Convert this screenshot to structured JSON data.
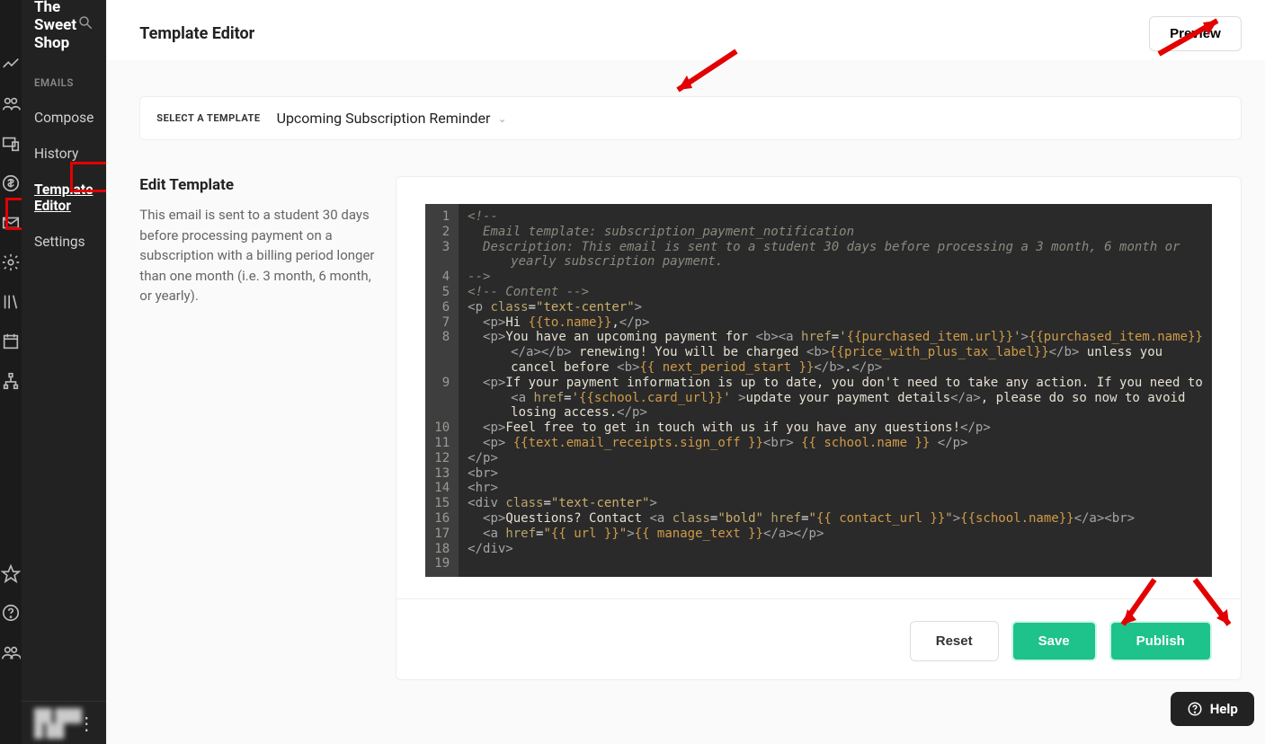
{
  "site_name": "The Sweet Shop",
  "sidebar": {
    "section_label": "EMAILS",
    "items": [
      {
        "label": "Compose"
      },
      {
        "label": "History"
      },
      {
        "label": "Template Editor"
      },
      {
        "label": "Settings"
      }
    ]
  },
  "footer_text": "██ ███ █ ██",
  "header": {
    "title": "Template Editor",
    "preview_label": "Preview"
  },
  "template_select": {
    "label": "SELECT A TEMPLATE",
    "value": "Upcoming Subscription Reminder"
  },
  "edit_info": {
    "title": "Edit Template",
    "description": "This email is sent to a student 30 days before processing payment on a subscription with a billing period longer than one month (i.e. 3 month, 6 month, or yearly)."
  },
  "actions": {
    "reset": "Reset",
    "save": "Save",
    "publish": "Publish"
  },
  "help_label": "Help",
  "code": {
    "lines": [
      {
        "n": 1,
        "html": "<span class='cm'>&lt;!--</span>"
      },
      {
        "n": 2,
        "html": "<span class='cm'>  Email template: subscription_payment_notification</span>"
      },
      {
        "n": 3,
        "html": "<span class='cm'>  Description: This email is sent to a student 30 days before processing a 3 month, 6 month or</span><span class='wrap cm'>yearly subscription payment.</span>"
      },
      {
        "n": 4,
        "html": "<span class='cm'>--&gt;</span>"
      },
      {
        "n": 5,
        "html": "<span class='cm'>&lt;!-- Content --&gt;</span>"
      },
      {
        "n": 6,
        "html": "<span class='tag'>&lt;p </span><span class='attr'>class</span>=<span class='str'>\"text-center\"</span><span class='tag'>&gt;</span>"
      },
      {
        "n": 7,
        "html": "  <span class='tag'>&lt;p&gt;</span><span class='txt'>Hi </span><span class='var'>{{to.name}}</span><span class='txt'>,</span><span class='tag'>&lt;/p&gt;</span>"
      },
      {
        "n": 8,
        "html": "  <span class='tag'>&lt;p&gt;</span><span class='txt'>You have an upcoming payment for </span><span class='tag'>&lt;b&gt;&lt;a </span><span class='attr'>href</span>=<span class='str'>'</span><span class='var'>{{purchased_item.url}}</span><span class='str'>'</span><span class='tag'>&gt;</span><span class='var'>{{purchased_item.name}}</span><span class='wrap'><span class='tag'>&lt;/a&gt;&lt;/b&gt;</span><span class='txt'> renewing! You will be charged </span><span class='tag'>&lt;b&gt;</span><span class='var'>{{price_with_plus_tax_label}}</span><span class='tag'>&lt;/b&gt;</span><span class='txt'> unless you</span></span><span class='wrap'><span class='txt'>cancel before </span><span class='tag'>&lt;b&gt;</span><span class='var'>{{ next_period_start }}</span><span class='tag'>&lt;/b&gt;</span><span class='txt'>.</span><span class='tag'>&lt;/p&gt;</span></span>"
      },
      {
        "n": 9,
        "html": "  <span class='tag'>&lt;p&gt;</span><span class='txt'>If your payment information is up to date, you don't need to take any action. If you need to</span><span class='wrap'><span class='tag'>&lt;a </span><span class='attr'>href</span>=<span class='str'>'</span><span class='var'>{{school.card_url}}</span><span class='str'>'</span><span class='tag'> &gt;</span><span class='txt'>update your payment details</span><span class='tag'>&lt;/a&gt;</span><span class='txt'>, please do so now to avoid</span></span><span class='wrap'><span class='txt'>losing access.</span><span class='tag'>&lt;/p&gt;</span></span>"
      },
      {
        "n": 10,
        "html": "  <span class='tag'>&lt;p&gt;</span><span class='txt'>Feel free to get in touch with us if you have any questions!</span><span class='tag'>&lt;/p&gt;</span>"
      },
      {
        "n": 11,
        "html": "  <span class='tag'>&lt;p&gt;</span> <span class='var'>{{text.email_receipts.sign_off }}</span><span class='tag'>&lt;br&gt;</span> <span class='var'>{{ school.name }}</span> <span class='tag'>&lt;/p&gt;</span>"
      },
      {
        "n": 12,
        "html": "<span class='tag'>&lt;/p&gt;</span>"
      },
      {
        "n": 13,
        "html": "<span class='tag'>&lt;br&gt;</span>"
      },
      {
        "n": 14,
        "html": "<span class='tag'>&lt;hr&gt;</span>"
      },
      {
        "n": 15,
        "html": "<span class='tag'>&lt;div </span><span class='attr'>class</span>=<span class='str'>\"text-center\"</span><span class='tag'>&gt;</span>"
      },
      {
        "n": 16,
        "html": "  <span class='tag'>&lt;p&gt;</span><span class='txt'>Questions? Contact </span><span class='tag'>&lt;a </span><span class='attr'>class</span>=<span class='str'>\"bold\"</span> <span class='attr'>href</span>=<span class='str'>\"</span><span class='var'>{{ contact_url }}</span><span class='str'>\"</span><span class='tag'>&gt;</span><span class='var'>{{school.name}}</span><span class='tag'>&lt;/a&gt;&lt;br&gt;</span>"
      },
      {
        "n": 17,
        "html": "  <span class='tag'>&lt;a </span><span class='attr'>href</span>=<span class='str'>\"</span><span class='var'>{{ url }}</span><span class='str'>\"</span><span class='tag'>&gt;</span><span class='var'>{{ manage_text }}</span><span class='tag'>&lt;/a&gt;&lt;/p&gt;</span>"
      },
      {
        "n": 18,
        "html": "<span class='tag'>&lt;/div&gt;</span>"
      },
      {
        "n": 19,
        "html": ""
      }
    ]
  }
}
